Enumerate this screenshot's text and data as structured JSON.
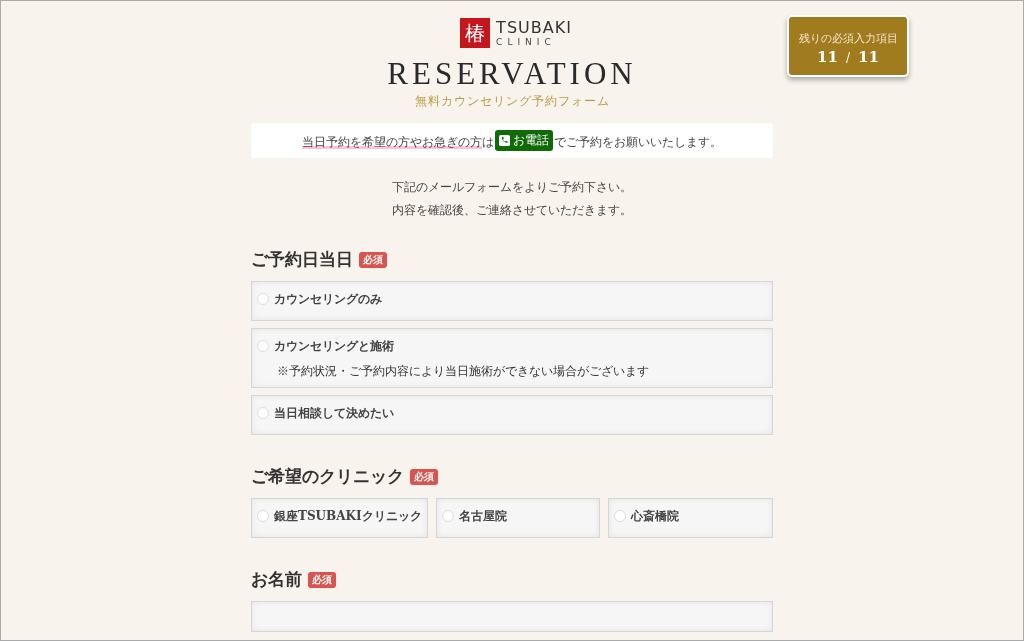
{
  "logo": {
    "mark": "椿",
    "name": "TSUBAKI",
    "sub": "CLINIC"
  },
  "title": "RESERVATION",
  "subtitle": "無料カウンセリング予約フォーム",
  "counter": {
    "label": "残りの必須入力項目",
    "remaining": "11",
    "separator": "/",
    "total": "11"
  },
  "notice": {
    "highlight": "当日予約を希望の方やお急ぎの方",
    "middle": "は",
    "phone_link": "お電話",
    "rest": "でご予約をお願いいたします。"
  },
  "intro": [
    "下記のメールフォームをよりご予約下さい。",
    "内容を確認後、ご連絡させていただきます。"
  ],
  "sections": [
    {
      "kind": "radio-list",
      "heading": "ご予約日当日",
      "badge": "必須",
      "options": [
        {
          "label": "カウンセリングのみ",
          "selected": false
        },
        {
          "label": "カウンセリングと施術",
          "note": "※予約状況・ご予約内容により当日施術ができない場合がございます",
          "selected": false
        },
        {
          "label": "当日相談して決めたい",
          "selected": false
        }
      ]
    },
    {
      "kind": "radio-row",
      "heading": "ご希望のクリニック",
      "badge": "必須",
      "options": [
        {
          "label": "銀座TSUBAKIクリニック",
          "selected": false
        },
        {
          "label": "名古屋院",
          "selected": false
        },
        {
          "label": "心斎橋院",
          "selected": false
        }
      ]
    },
    {
      "kind": "text",
      "heading": "お名前",
      "badge": "必須"
    }
  ]
}
